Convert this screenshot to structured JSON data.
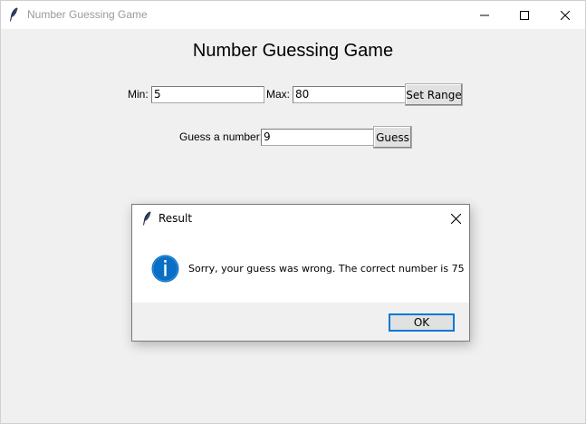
{
  "window": {
    "title": "Number Guessing Game",
    "controls": [
      "minimize",
      "maximize",
      "close"
    ]
  },
  "main": {
    "heading": "Number Guessing Game",
    "range": {
      "min_label": "Min:",
      "min_value": "5",
      "max_label": "Max:",
      "max_value": "80",
      "set_button": "Set Range"
    },
    "guess": {
      "label": "Guess a number:",
      "value": "9",
      "button": "Guess"
    }
  },
  "dialog": {
    "title": "Result",
    "message": "Sorry, your guess was wrong. The correct number is 75",
    "ok_button": "OK",
    "icon": "info-icon"
  },
  "colors": {
    "background": "#f0f0f0",
    "accent": "#0078d7",
    "info_icon": "#0a6fc4"
  }
}
